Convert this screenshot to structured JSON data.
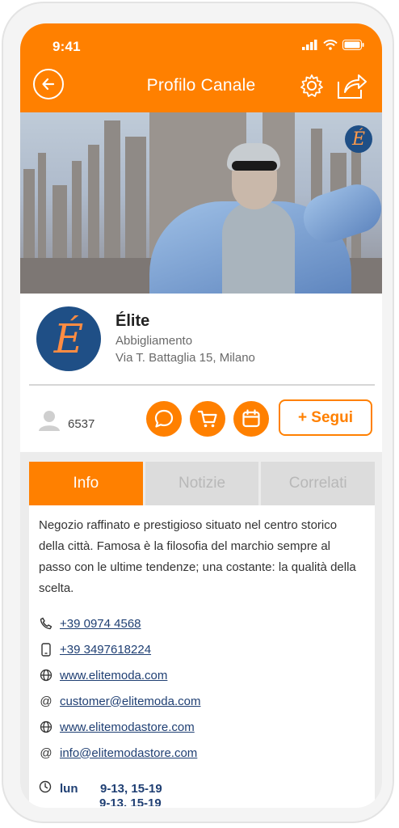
{
  "status": {
    "time": "9:41"
  },
  "header": {
    "title": "Profilo Canale"
  },
  "shop": {
    "name": "Élite",
    "category": "Abbigliamento",
    "address": "Via T. Battaglia 15, Milano",
    "logo_glyph": "É"
  },
  "followers": {
    "count": "6537"
  },
  "follow_button": {
    "label": "+ Segui"
  },
  "tabs": [
    {
      "label": "Info",
      "active": true
    },
    {
      "label": "Notizie",
      "active": false
    },
    {
      "label": "Correlati",
      "active": false
    }
  ],
  "info": {
    "description": "Negozio raffinato e prestigioso situato nel centro storico della città. Famosa è la filosofia del marchio sempre al passo con le ultime tendenze; una costante: la qualità della scelta.",
    "contacts": [
      {
        "icon": "phone-icon",
        "text": "+39 0974 4568"
      },
      {
        "icon": "mobile-icon",
        "text": "+39 3497618224"
      },
      {
        "icon": "globe-icon",
        "text": "www.elitemoda.com"
      },
      {
        "icon": "at-icon",
        "text": "customer@elitemoda.com"
      },
      {
        "icon": "globe-icon",
        "text": "www.elitemodastore.com"
      },
      {
        "icon": "at-icon",
        "text": "info@elitemodastore.com"
      }
    ],
    "hours": {
      "day": "lun",
      "time": "9-13, 15-19",
      "next_time": "9-13, 15-19"
    }
  },
  "colors": {
    "accent": "#ff8000",
    "link": "#1f3f73",
    "logo_bg": "#1f4f86"
  }
}
